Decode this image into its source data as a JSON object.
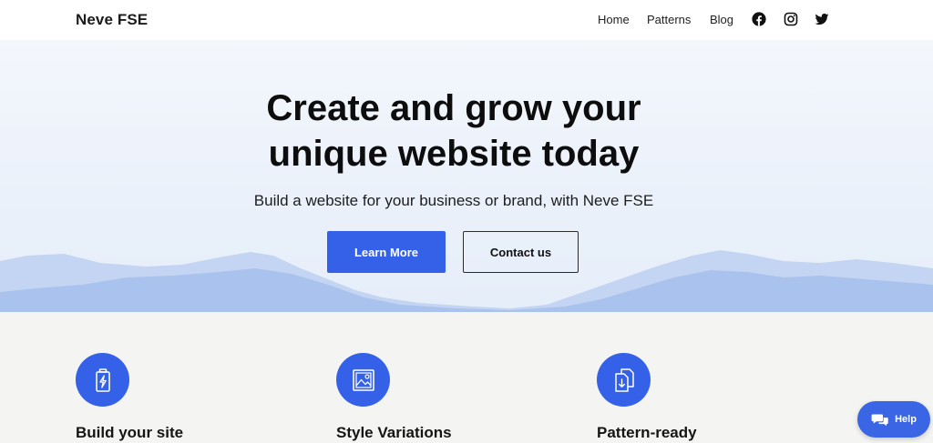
{
  "header": {
    "brand": "Neve FSE",
    "nav": [
      {
        "label": "Home"
      },
      {
        "label": "Patterns"
      },
      {
        "label": "Blog"
      }
    ],
    "social_icons": [
      "facebook-icon",
      "instagram-icon",
      "twitter-icon"
    ]
  },
  "hero": {
    "title_line1": "Create and grow your",
    "title_line2": "unique website today",
    "subtitle": "Build a website for your business or brand, with Neve FSE",
    "primary_button": "Learn More",
    "secondary_button": "Contact us"
  },
  "features": [
    {
      "title": "Build your site",
      "icon": "battery-bolt-icon"
    },
    {
      "title": "Style Variations",
      "icon": "image-icon"
    },
    {
      "title": "Pattern-ready",
      "icon": "documents-download-icon"
    }
  ],
  "help_widget": {
    "label": "Help",
    "icon": "chat-bubbles-icon"
  },
  "colors": {
    "accent": "#3461e8",
    "hero_bg": "#eef3fb",
    "features_bg": "#f4f4f2"
  }
}
